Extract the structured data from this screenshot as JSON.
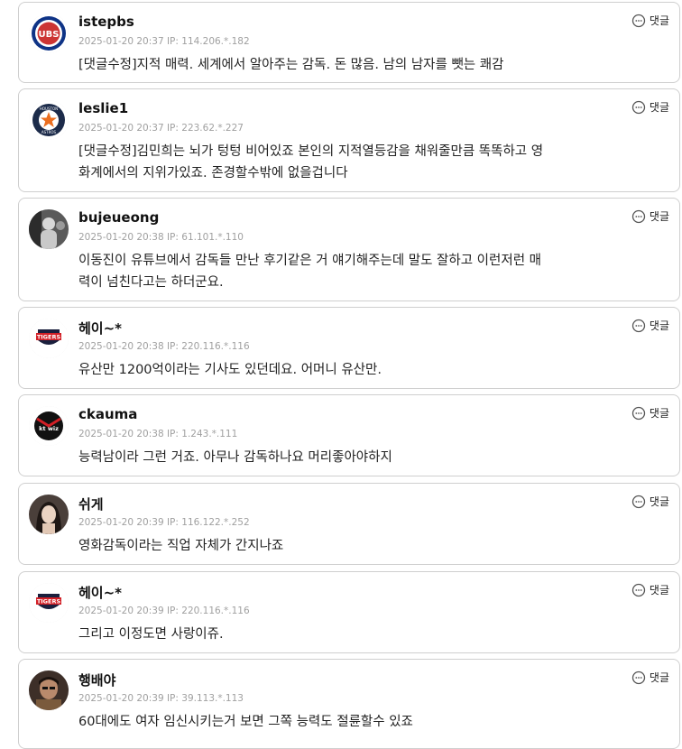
{
  "reply_label": "댓글",
  "comments": [
    {
      "nick": "istepbs",
      "meta": "2025-01-20 20:37  IP: 114.206.*.182",
      "lines": [
        "[댓글수정]지적 매력. 세계에서 알아주는 감독. 돈 많음. 남의 남자를 뺏는 쾌감"
      ],
      "avatar": "cubs-logo"
    },
    {
      "nick": "leslie1",
      "meta": "2025-01-20 20:37  IP: 223.62.*.227",
      "lines": [
        "[댓글수정]김민희는 뇌가 텅텅 비어있죠 본인의 지적열등감을 채워줄만큼 똑똑하고 영",
        "화계에서의 지위가있죠. 존경할수밖에 없을겁니다"
      ],
      "avatar": "astros-logo"
    },
    {
      "nick": "bujeueong",
      "meta": "2025-01-20 20:38  IP: 61.101.*.110",
      "lines": [
        "이동진이 유튜브에서 감독들 만난 후기같은 거 얘기해주는데 말도 잘하고 이런저런 매",
        "력이 넘친다고는 하더군요."
      ],
      "avatar": "photo-avatar"
    },
    {
      "nick": "헤이~*",
      "meta": "2025-01-20 20:38  IP: 220.116.*.116",
      "lines": [
        "유산만 1200억이라는 기사도 있던데요. 어머니 유산만."
      ],
      "avatar": "tigers-logo"
    },
    {
      "nick": "ckauma",
      "meta": "2025-01-20 20:38  IP: 1.243.*.111",
      "lines": [
        "능력남이라 그런 거죠. 아무나 감독하나요 머리좋아야하지"
      ],
      "avatar": "ktwiz-logo"
    },
    {
      "nick": "쉬게",
      "meta": "2025-01-20 20:39  IP: 116.122.*.252",
      "lines": [
        "영화감독이라는 직업 자체가 간지나죠"
      ],
      "avatar": "photo-avatar"
    },
    {
      "nick": "헤이~*",
      "meta": "2025-01-20 20:39  IP: 220.116.*.116",
      "lines": [
        "그리고 이정도면 사랑이쥬."
      ],
      "avatar": "tigers-logo"
    },
    {
      "nick": "행배야",
      "meta": "2025-01-20 20:39  IP: 39.113.*.113",
      "lines": [
        "60대에도 여자 임신시키는거 보면 그쪽 능력도 절륜할수 있죠"
      ],
      "avatar": "photo-avatar"
    }
  ]
}
